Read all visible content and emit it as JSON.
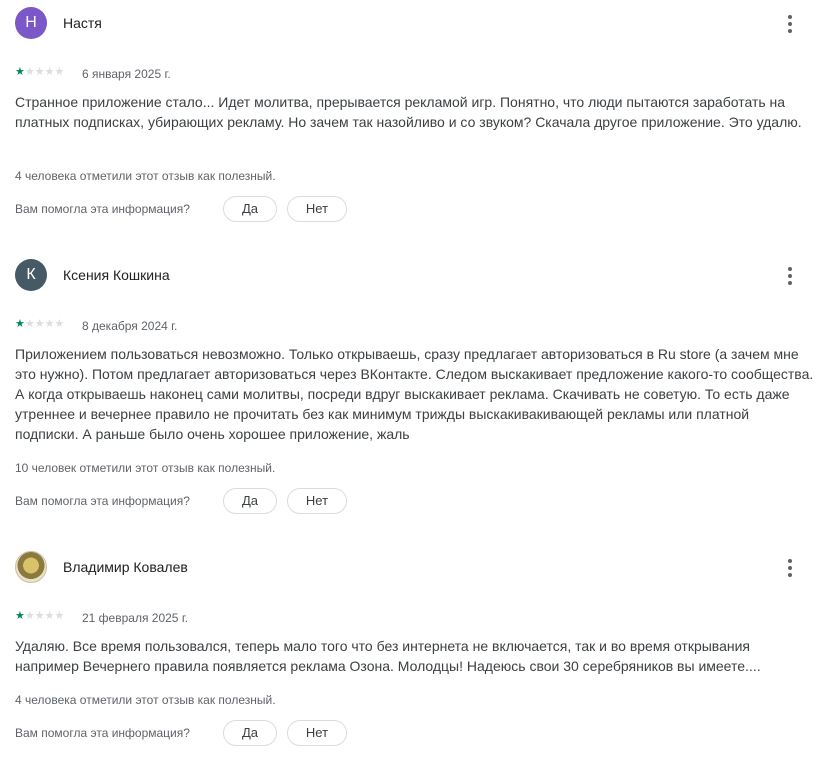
{
  "colors": {
    "star_filled": "#01875f",
    "star_empty": "#dadce0",
    "avatar_1": "#7b57c8",
    "avatar_2": "#455a64"
  },
  "reviews": [
    {
      "author": "Настя",
      "avatar_letter": "Н",
      "rating": 1,
      "date": "6 января 2025 г.",
      "text": "Странное приложение стало... Идет молитва, прерывается рекламой игр. Понятно, что люди пытаются заработать на платных подписках, убирающих рекламу. Но зачем так назойливо и со звуком? Скачала другое приложение. Это удалю.",
      "helpful": "4 человека отметили этот отзыв как полезный.",
      "question": "Вам помогла эта информация?",
      "yes": "Да",
      "no": "Нет"
    },
    {
      "author": "Ксения Кошкина",
      "avatar_letter": "К",
      "rating": 1,
      "date": "8 декабря 2024 г.",
      "text": "Приложением пользоваться невозможно. Только открываешь, сразу предлагает авторизоваться в Ru store (а зачем мне это нужно). Потом предлагает авторизоваться через ВКонтакте. Следом выскакивает предложение какого-то сообщества. А когда открываешь наконец сами молитвы, посреди вдруг выскакивает реклама. Скачивать не советую. То есть даже утреннее и вечернее правило не прочитать без как минимум трижды выскакивакивающей рекламы или платной подписки. А раньше было очень хорошее приложение, жаль",
      "helpful": "10 человек отметили этот отзыв как полезный.",
      "question": "Вам помогла эта информация?",
      "yes": "Да",
      "no": "Нет"
    },
    {
      "author": "Владимир Ковалев",
      "avatar_letter": "",
      "rating": 1,
      "date": "21 февраля 2025 г.",
      "text": "Удаляю. Все время пользовался, теперь мало того что без интернета не включается, так и во время открывания например Вечернего правила появляется реклама Озона. Молодцы! Надеюсь свои 30 серебряников вы имеете....",
      "helpful": "4 человека отметили этот отзыв как полезный.",
      "question": "Вам помогла эта информация?",
      "yes": "Да",
      "no": "Нет"
    }
  ]
}
